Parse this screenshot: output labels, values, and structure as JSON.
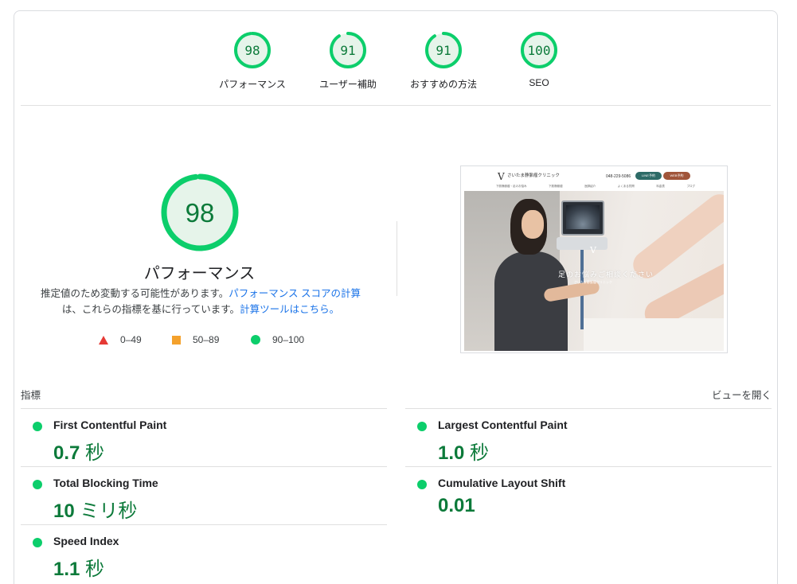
{
  "top_gauges": [
    {
      "score": "98",
      "label": "パフォーマンス",
      "fraction": 0.98
    },
    {
      "score": "91",
      "label": "ユーザー補助",
      "fraction": 0.91
    },
    {
      "score": "91",
      "label": "おすすめの方法",
      "fraction": 0.91
    },
    {
      "score": "100",
      "label": "SEO",
      "fraction": 1.0
    }
  ],
  "main": {
    "score": "98",
    "fraction": 0.98,
    "title": "パフォーマンス",
    "desc_part1": "推定値のため変動する可能性があります。",
    "desc_link1": "パフォーマンス スコアの計算",
    "desc_part2": "は、これらの指標を基に行っています。",
    "desc_link2": "計算ツールはこちら。"
  },
  "legend": {
    "fail": "0–49",
    "average": "50–89",
    "pass": "90–100"
  },
  "preview": {
    "site_name": "さいたま静脈瘤クリニック",
    "phone": "048-229-5086",
    "line_button": "LINE予約",
    "booking_button": "WEB予約",
    "menu": [
      "下肢静脈瘤・足のお悩み",
      "下肢静脈瘤",
      "医師紹介",
      "よくある質問",
      "料金表",
      "ブログ"
    ],
    "hero_copy": "足のお悩みご相談ください",
    "hero_sub": "さいたま静脈瘤クリニック"
  },
  "metrics_section": {
    "title": "指標",
    "view_toggle": "ビューを開く"
  },
  "metrics": [
    {
      "label": "First Contentful Paint",
      "value": "0.7",
      "unit": "秒"
    },
    {
      "label": "Largest Contentful Paint",
      "value": "1.0",
      "unit": "秒"
    },
    {
      "label": "Total Blocking Time",
      "value": "10",
      "unit": "ミリ秒"
    },
    {
      "label": "Cumulative Layout Shift",
      "value": "0.01",
      "unit": ""
    },
    {
      "label": "Speed Index",
      "value": "1.1",
      "unit": "秒"
    }
  ],
  "colors": {
    "pass": "#0cce6b",
    "pass_text": "#0c7a3a",
    "pass_fill": "#e6f4ea",
    "average": "#f4a12c",
    "fail": "#e53935",
    "link": "#1a73e8"
  }
}
